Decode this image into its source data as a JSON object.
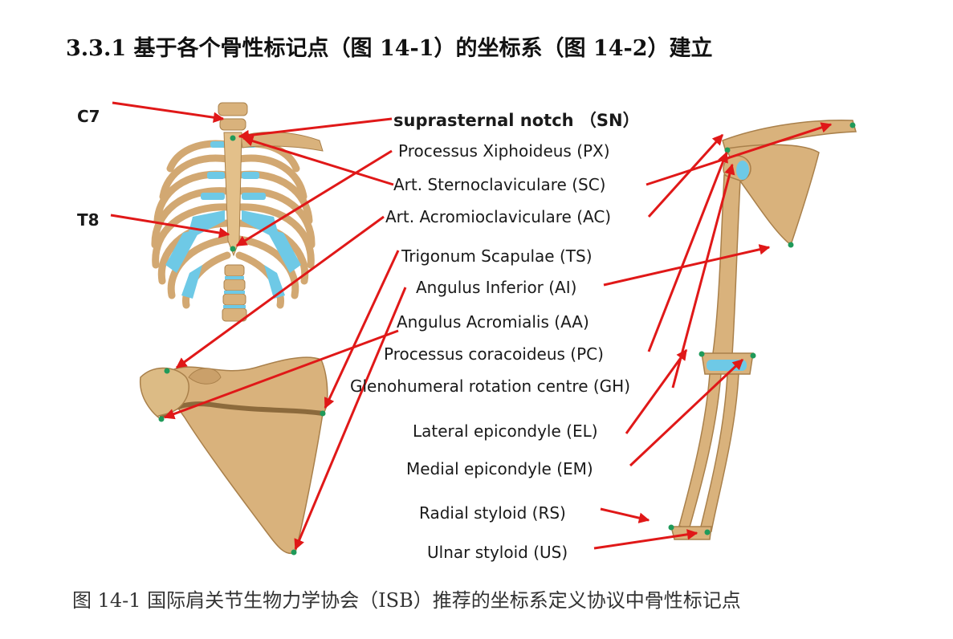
{
  "heading": "3.3.1  基于各个骨性标记点（图 14-1）的坐标系（图 14-2）建立",
  "caption": "图 14-1  国际肩关节生物力学协会（ISB）推荐的坐标系定义协议中骨性标记点",
  "side_labels": {
    "c7": "C7",
    "t8": "T8"
  },
  "landmarks": [
    "suprasternal notch （SN）",
    "Processus Xiphoideus (PX)",
    "Art. Sternoclaviculare (SC)",
    "Art. Acromioclaviculare (AC)",
    "Trigonum Scapulae (TS)",
    "Angulus Inferior (AI)",
    "Angulus Acromialis (AA)",
    "Processus coracoideus (PC)",
    "Glenohumeral rotation centre (GH)",
    "Lateral epicondyle (EL)",
    "Medial epicondyle (EM)",
    "Radial styloid (RS)",
    "Ulnar styloid (US)"
  ],
  "colors": {
    "arrow": "#e01818",
    "bone": "#d9b27c",
    "bone_dark": "#a9804b",
    "cartilage": "#6ec9e6",
    "marker": "#1f9a5a"
  }
}
